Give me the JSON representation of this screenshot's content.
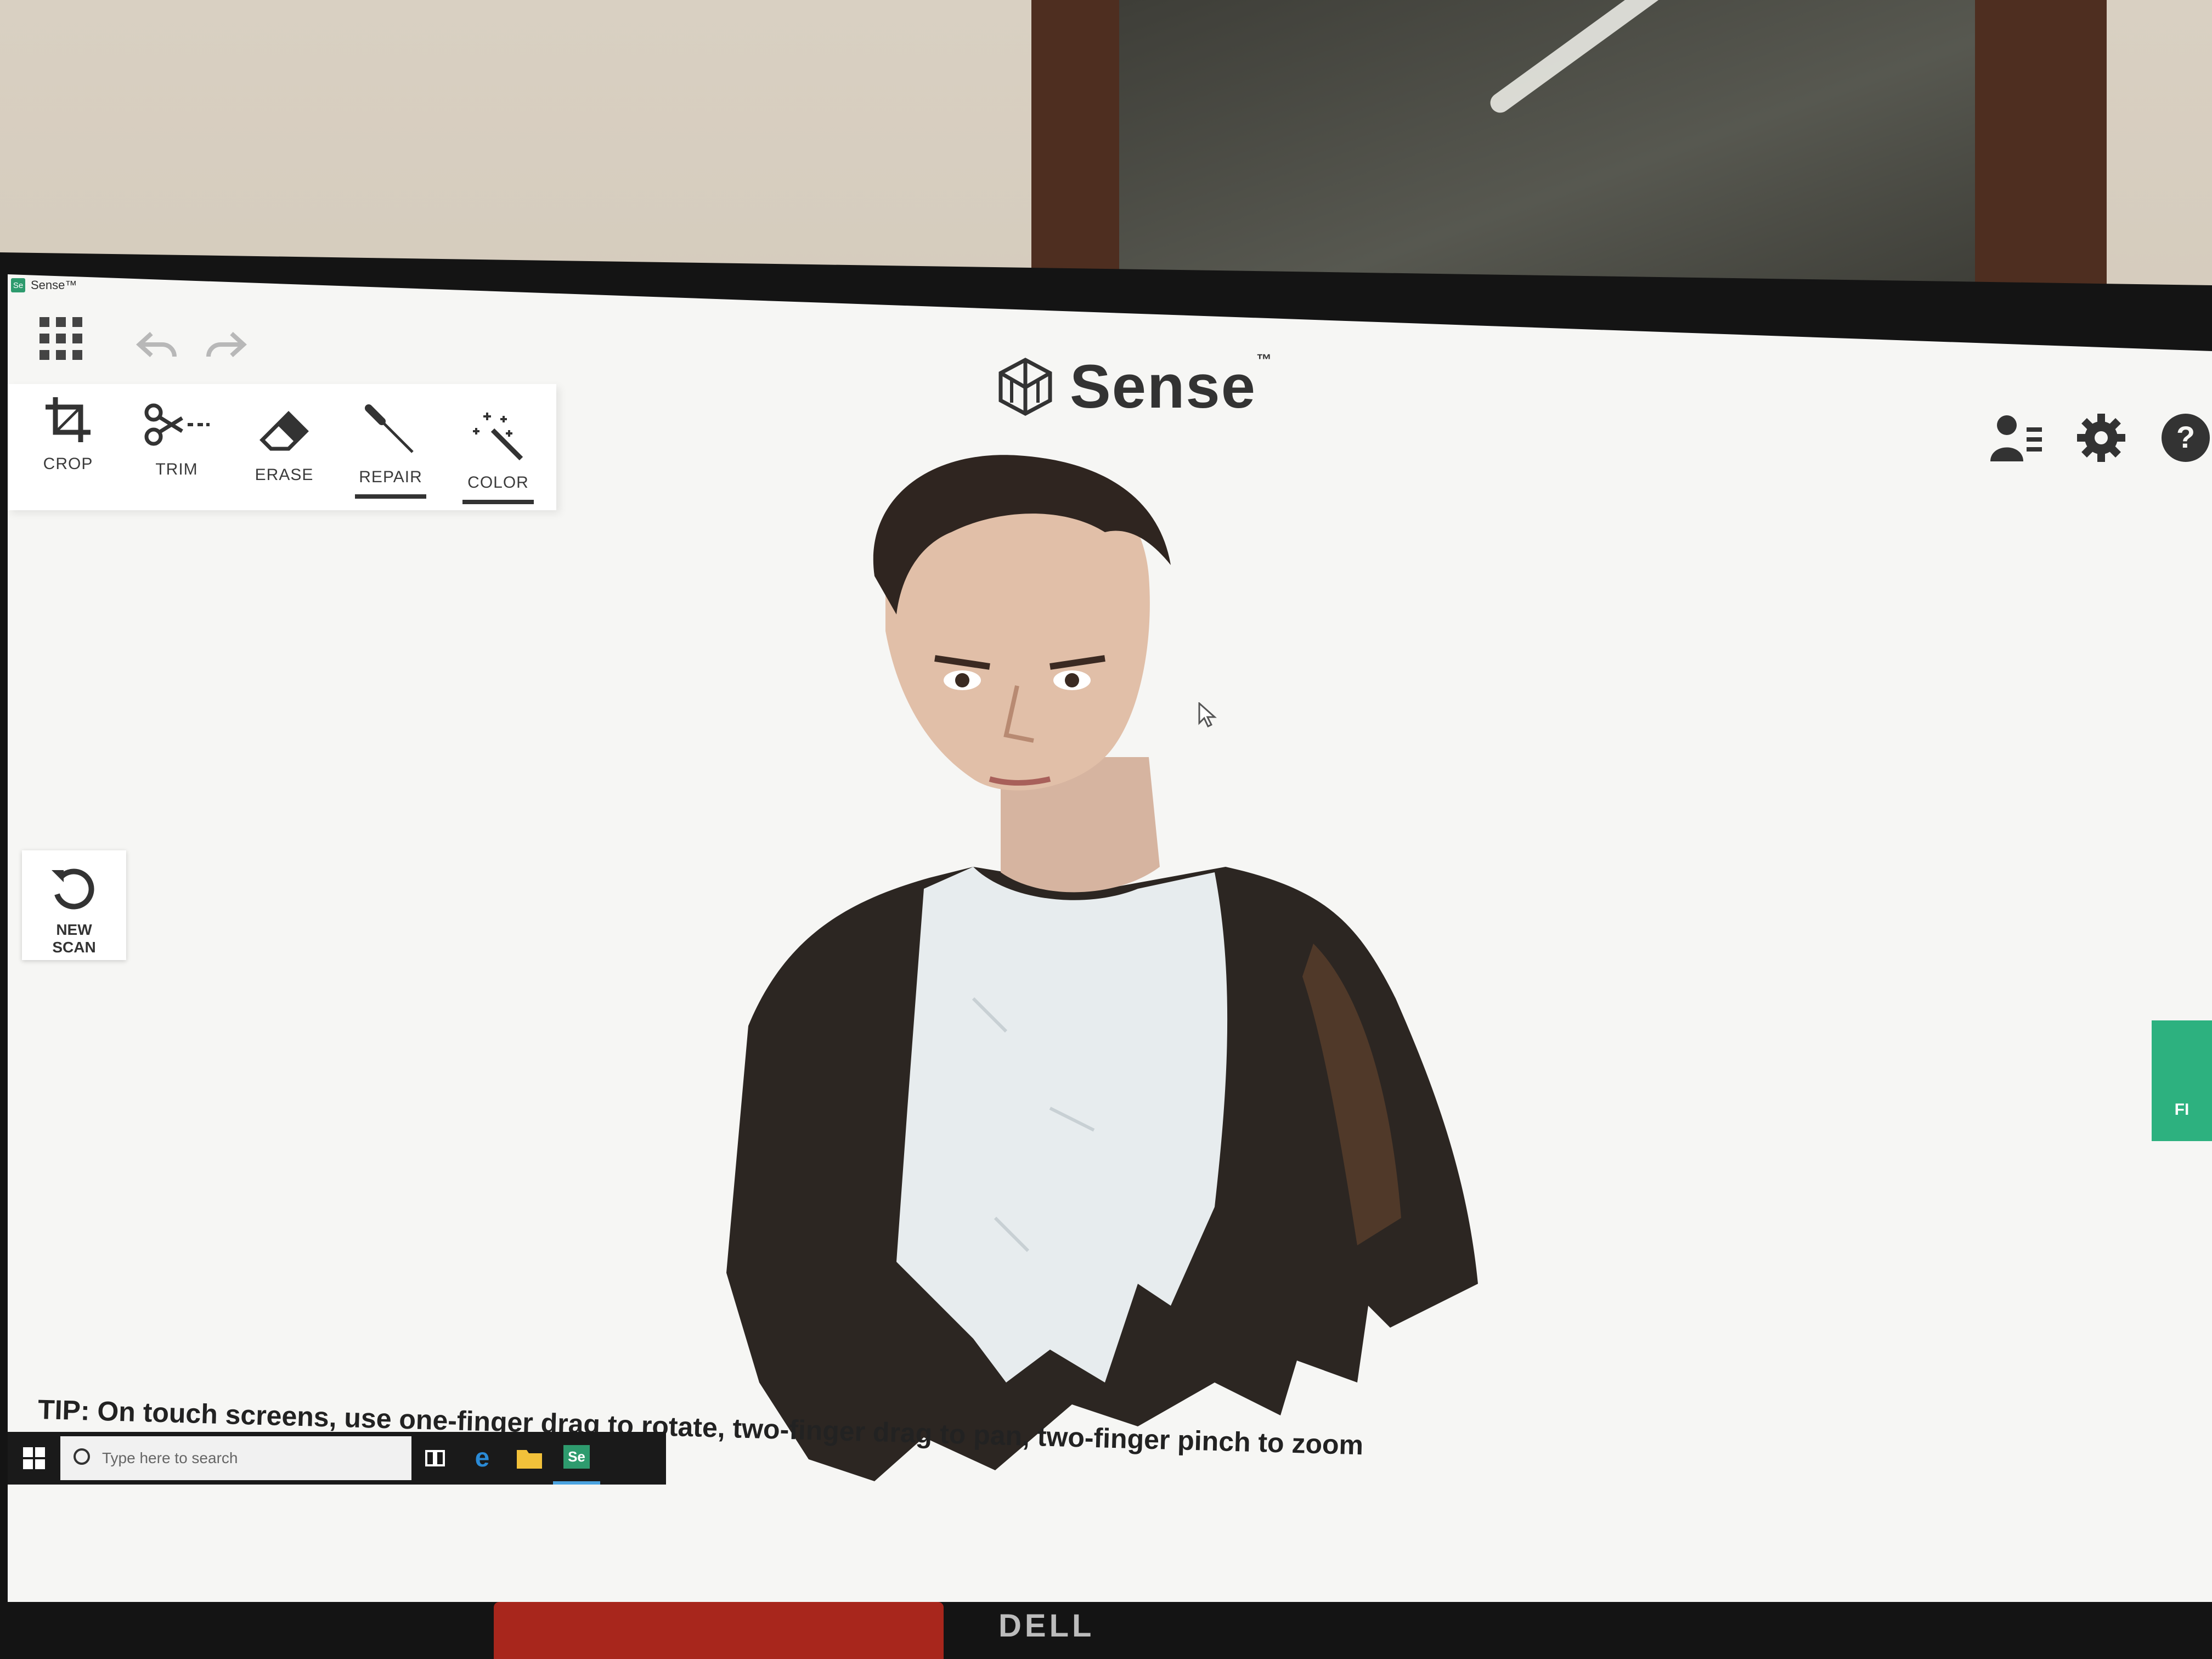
{
  "window": {
    "title": "Sense™",
    "app_icon_text": "Se"
  },
  "brand": {
    "name": "Sense",
    "trademark": "™"
  },
  "toolbar": {
    "tools": [
      {
        "label": "CROP"
      },
      {
        "label": "TRIM"
      },
      {
        "label": "ERASE"
      },
      {
        "label": "REPAIR"
      },
      {
        "label": "COLOR"
      }
    ]
  },
  "side": {
    "new_scan_label": "NEW SCAN"
  },
  "finalize": {
    "label": "FI"
  },
  "tip": {
    "text": "TIP: On touch screens, use one-finger drag to rotate, two-finger drag to pan, two-finger pinch to zoom"
  },
  "taskbar": {
    "search_placeholder": "Type here to search",
    "sense_icon_text": "Se"
  },
  "monitor": {
    "brand": "DELL"
  },
  "colors": {
    "accent": "#2db17f",
    "taskbar": "#1a1a1a",
    "toolbar_text": "#3b3b3b"
  }
}
